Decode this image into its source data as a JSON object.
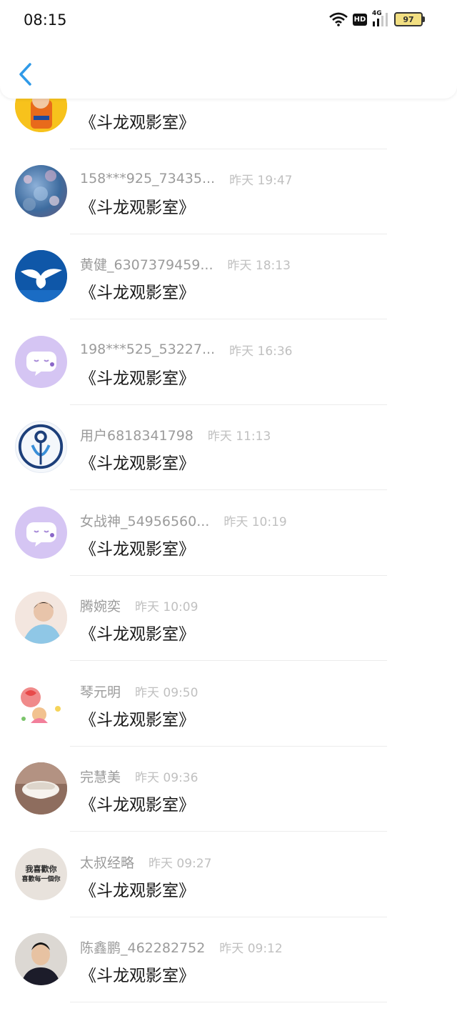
{
  "status_bar": {
    "time": "08:15",
    "hd_label": "HD",
    "network_label": "4G",
    "battery_level": "97",
    "icons": [
      "wifi-icon",
      "hd-icon",
      "signal-icon",
      "battery-icon"
    ]
  },
  "header": {
    "back_icon": "chevron-left-icon",
    "accent_color": "#2f9ae8"
  },
  "comments": [
    {
      "name": "",
      "time": "",
      "text": "《斗龙观影室》",
      "avatar": "avatar-cartoon-hero"
    },
    {
      "name": "158***925_73435...",
      "time": "昨天 19:47",
      "text": "《斗龙观影室》",
      "avatar": "avatar-nature-photo"
    },
    {
      "name": "黄健_6307379459...",
      "time": "昨天 18:13",
      "text": "《斗龙观影室》",
      "avatar": "avatar-dove"
    },
    {
      "name": "198***525_53227...",
      "time": "昨天 16:36",
      "text": "《斗龙观影室》",
      "avatar": "avatar-default-bubble"
    },
    {
      "name": "用户6818341798",
      "time": "昨天 11:13",
      "text": "《斗龙观影室》",
      "avatar": "avatar-logo"
    },
    {
      "name": "女战神_54956560...",
      "time": "昨天 10:19",
      "text": "《斗龙观影室》",
      "avatar": "avatar-default-bubble"
    },
    {
      "name": "腾婉奕",
      "time": "昨天 10:09",
      "text": "《斗龙观影室》",
      "avatar": "avatar-person-photo"
    },
    {
      "name": "琴元明",
      "time": "昨天 09:50",
      "text": "《斗龙观影室》",
      "avatar": "avatar-cartoon-balloon"
    },
    {
      "name": "完慧美",
      "time": "昨天 09:36",
      "text": "《斗龙观影室》",
      "avatar": "avatar-bowl-photo"
    },
    {
      "name": "太叔经略",
      "time": "昨天 09:27",
      "text": "《斗龙观影室》",
      "avatar": "avatar-text-image",
      "avatar_text": [
        "我喜歡你",
        "喜歡每一個你"
      ]
    },
    {
      "name": "陈鑫鹏_462282752",
      "time": "昨天 09:12",
      "text": "《斗龙观影室》",
      "avatar": "avatar-person-photo"
    }
  ]
}
